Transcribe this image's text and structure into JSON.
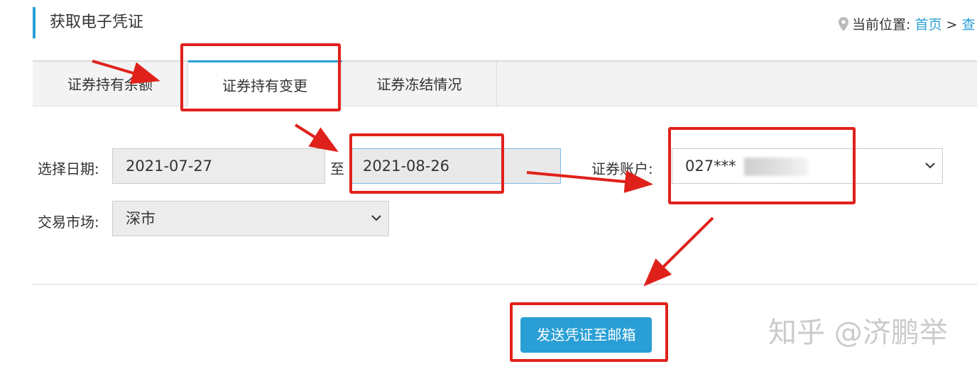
{
  "header": {
    "title": "获取电子凭证"
  },
  "breadcrumb": {
    "prefix": "当前位置:",
    "home": "首页",
    "separator": ">",
    "next": "查"
  },
  "tabs": [
    {
      "label": "证券持有余额",
      "active": false
    },
    {
      "label": "证券持有变更",
      "active": true
    },
    {
      "label": "证券冻结情况",
      "active": false
    }
  ],
  "form": {
    "date_label": "选择日期:",
    "start_date": "2021-07-27",
    "range_sep": "至",
    "end_date": "2021-08-26",
    "account_label": "证券账户:",
    "account_value": "027***",
    "market_label": "交易市场:",
    "market_value": "深市"
  },
  "actions": {
    "send_label": "发送凭证至邮箱"
  },
  "watermark": "知乎 @济鹏举",
  "colors": {
    "accent": "#2a9fd6",
    "annotation": "#e0211b"
  },
  "icons": [
    "location-pin-icon",
    "chevron-down-icon"
  ]
}
